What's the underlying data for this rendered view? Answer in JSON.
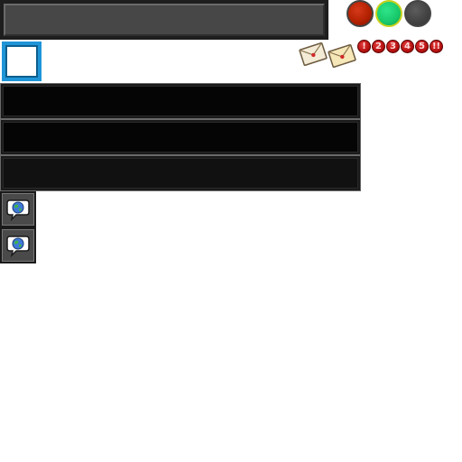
{
  "top_bar": {
    "text": ""
  },
  "status_orbs": [
    {
      "name": "red",
      "color": "#b02000"
    },
    {
      "name": "green",
      "color": "#18c86a",
      "ring": "#c8d21e"
    },
    {
      "name": "grey",
      "color": "#424242"
    }
  ],
  "selected_slot": {
    "color": "#1f95d8"
  },
  "mail": {
    "count": 2,
    "icons": [
      "envelope-icon",
      "envelope-icon"
    ]
  },
  "combo": {
    "labels": [
      "!",
      "2",
      "3",
      "4",
      "5",
      "!!"
    ],
    "color": "#b30f0f"
  },
  "bars": [
    {
      "text": ""
    },
    {
      "text": ""
    },
    {
      "text": ""
    }
  ],
  "chat_buttons": [
    {
      "icon": "globe-chat-icon"
    },
    {
      "icon": "globe-chat-icon"
    }
  ]
}
